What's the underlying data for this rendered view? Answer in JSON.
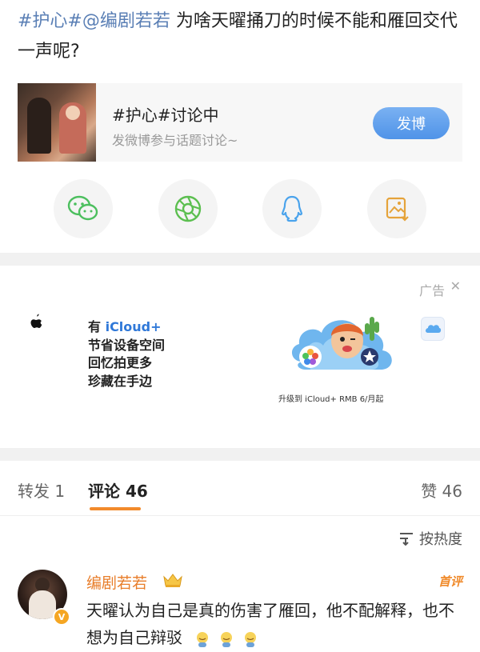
{
  "post": {
    "tag1": "#护心#",
    "mention": "@编剧若若",
    "text": " 为啥天曜捅刀的时候不能和雁回交代一声呢?"
  },
  "topic": {
    "title": "#护心#讨论中",
    "subtitle": "发微博参与话题讨论~",
    "button": "发博"
  },
  "share": {
    "icons": [
      "wechat-icon",
      "moments-icon",
      "qq-icon",
      "save-image-icon"
    ]
  },
  "ad": {
    "label": "广告",
    "line1_prefix": "有 ",
    "line1_highlight": "iCloud+",
    "line2": "节省设备空间",
    "line3": "回忆拍更多",
    "line4": "珍藏在手边",
    "caption": "升级到 iCloud+ RMB 6/月起"
  },
  "tabs": {
    "repost": "转发 1",
    "comments": "评论 46",
    "likes": "赞 46"
  },
  "sort": {
    "label": "按热度"
  },
  "comment": {
    "author": "编剧若若",
    "badge": "首评",
    "text": "天曜认为自己是真的伤害了雁回，他不配解释，也不想为自己辩驳"
  },
  "colors": {
    "link": "#5a7fb5",
    "accent": "#f28a2b",
    "button": "#4f93e8"
  }
}
